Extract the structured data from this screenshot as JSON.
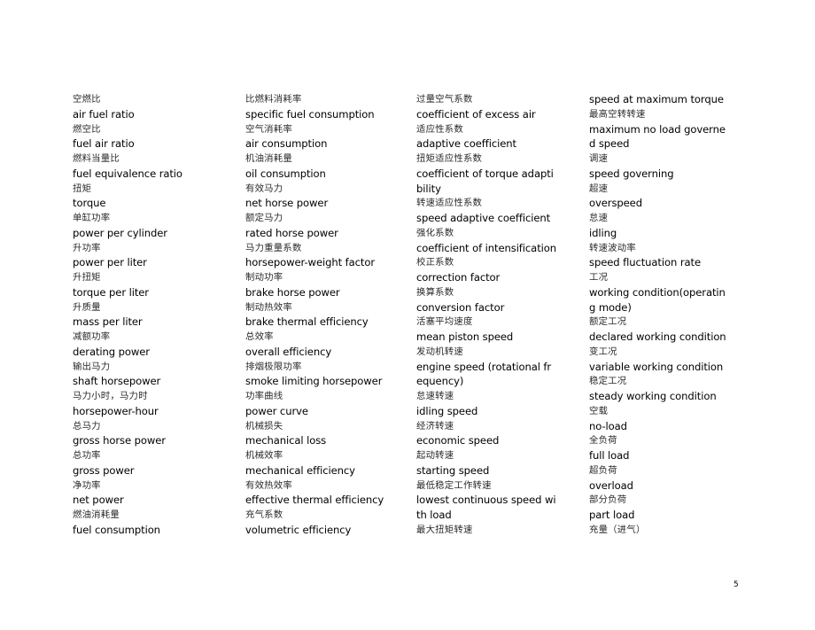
{
  "document": {
    "page_number": "5",
    "background_color": "#ffffff",
    "text_color": "#000000"
  },
  "columns": [
    {
      "id": "column-1",
      "lines": [
        {
          "text": "空燃比",
          "lang": "zh"
        },
        {
          "text": "air fuel ratio",
          "lang": "en"
        },
        {
          "text": "燃空比",
          "lang": "zh"
        },
        {
          "text": "fuel air ratio",
          "lang": "en"
        },
        {
          "text": "燃料当量比",
          "lang": "zh"
        },
        {
          "text": "fuel equivalence ratio",
          "lang": "en"
        },
        {
          "text": "扭矩",
          "lang": "zh"
        },
        {
          "text": "torque",
          "lang": "en"
        },
        {
          "text": "单缸功率",
          "lang": "zh"
        },
        {
          "text": "power per cylinder",
          "lang": "en"
        },
        {
          "text": "升功率",
          "lang": "zh"
        },
        {
          "text": "power per liter",
          "lang": "en"
        },
        {
          "text": "升扭矩",
          "lang": "zh"
        },
        {
          "text": "torque per liter",
          "lang": "en"
        },
        {
          "text": "升质量",
          "lang": "zh"
        },
        {
          "text": "mass per liter",
          "lang": "en"
        },
        {
          "text": "减额功率",
          "lang": "zh"
        },
        {
          "text": "derating power",
          "lang": "en"
        },
        {
          "text": "输出马力",
          "lang": "zh"
        },
        {
          "text": "shaft horsepower",
          "lang": "en"
        },
        {
          "text": "马力小时，马力时",
          "lang": "zh"
        },
        {
          "text": "horsepower-hour",
          "lang": "en"
        },
        {
          "text": "总马力",
          "lang": "zh"
        },
        {
          "text": "gross horse power",
          "lang": "en"
        },
        {
          "text": "总功率",
          "lang": "zh"
        },
        {
          "text": "gross power",
          "lang": "en"
        },
        {
          "text": "净功率",
          "lang": "zh"
        },
        {
          "text": "net power",
          "lang": "en"
        },
        {
          "text": "燃油消耗量",
          "lang": "zh"
        },
        {
          "text": "fuel consumption",
          "lang": "en"
        }
      ]
    },
    {
      "id": "column-2",
      "lines": [
        {
          "text": "比燃料消耗率",
          "lang": "zh"
        },
        {
          "text": "specific fuel consumption",
          "lang": "en"
        },
        {
          "text": "空气消耗率",
          "lang": "zh"
        },
        {
          "text": "air consumption",
          "lang": "en"
        },
        {
          "text": "机油消耗量",
          "lang": "zh"
        },
        {
          "text": "oil consumption",
          "lang": "en"
        },
        {
          "text": "有效马力",
          "lang": "zh"
        },
        {
          "text": "net horse power",
          "lang": "en"
        },
        {
          "text": "额定马力",
          "lang": "zh"
        },
        {
          "text": "rated horse power",
          "lang": "en"
        },
        {
          "text": "马力重量系数",
          "lang": "zh"
        },
        {
          "text": "horsepower-weight factor",
          "lang": "en"
        },
        {
          "text": "制动功率",
          "lang": "zh"
        },
        {
          "text": "brake horse power",
          "lang": "en"
        },
        {
          "text": "制动热效率",
          "lang": "zh"
        },
        {
          "text": "brake thermal efficiency",
          "lang": "en"
        },
        {
          "text": "总效率",
          "lang": "zh"
        },
        {
          "text": "overall efficiency",
          "lang": "en"
        },
        {
          "text": "排烟极限功率",
          "lang": "zh"
        },
        {
          "text": "smoke limiting horsepower",
          "lang": "en"
        },
        {
          "text": "功率曲线",
          "lang": "zh"
        },
        {
          "text": "power curve",
          "lang": "en"
        },
        {
          "text": "机械损失",
          "lang": "zh"
        },
        {
          "text": "mechanical loss",
          "lang": "en"
        },
        {
          "text": "机械效率",
          "lang": "zh"
        },
        {
          "text": "mechanical efficiency",
          "lang": "en"
        },
        {
          "text": "有效热效率",
          "lang": "zh"
        },
        {
          "text": "effective thermal efficiency",
          "lang": "en"
        },
        {
          "text": "充气系数",
          "lang": "zh"
        },
        {
          "text": "volumetric efficiency",
          "lang": "en"
        }
      ]
    },
    {
      "id": "column-3",
      "lines": [
        {
          "text": "过量空气系数",
          "lang": "zh"
        },
        {
          "text": "coefficient of excess air",
          "lang": "en"
        },
        {
          "text": "适应性系数",
          "lang": "zh"
        },
        {
          "text": "adaptive coefficient",
          "lang": "en"
        },
        {
          "text": "扭矩适应性系数",
          "lang": "zh"
        },
        {
          "text": "coefficient of torque adapti",
          "lang": "en"
        },
        {
          "text": "bility",
          "lang": "en"
        },
        {
          "text": "转速适应性系数",
          "lang": "zh"
        },
        {
          "text": "speed adaptive coefficient",
          "lang": "en"
        },
        {
          "text": "强化系数",
          "lang": "zh"
        },
        {
          "text": "coefficient of intensification",
          "lang": "en"
        },
        {
          "text": "校正系数",
          "lang": "zh"
        },
        {
          "text": "correction factor",
          "lang": "en"
        },
        {
          "text": "换算系数",
          "lang": "zh"
        },
        {
          "text": "conversion factor",
          "lang": "en"
        },
        {
          "text": "活塞平均速度",
          "lang": "zh"
        },
        {
          "text": "mean piston speed",
          "lang": "en"
        },
        {
          "text": "发动机转速",
          "lang": "zh"
        },
        {
          "text": "engine speed (rotational fr",
          "lang": "en"
        },
        {
          "text": "equency)",
          "lang": "en"
        },
        {
          "text": "怠速转速",
          "lang": "zh"
        },
        {
          "text": "idling speed",
          "lang": "en"
        },
        {
          "text": "经济转速",
          "lang": "zh"
        },
        {
          "text": "economic speed",
          "lang": "en"
        },
        {
          "text": "起动转速",
          "lang": "zh"
        },
        {
          "text": "starting speed",
          "lang": "en"
        },
        {
          "text": "最低稳定工作转速",
          "lang": "zh"
        },
        {
          "text": "lowest continuous speed wi",
          "lang": "en"
        },
        {
          "text": "th load",
          "lang": "en"
        },
        {
          "text": "最大扭矩转速",
          "lang": "zh"
        }
      ]
    },
    {
      "id": "column-4",
      "lines": [
        {
          "text": "speed at maximum torque",
          "lang": "en"
        },
        {
          "text": "最高空转转速",
          "lang": "zh"
        },
        {
          "text": "maximum no load governe",
          "lang": "en"
        },
        {
          "text": "d speed",
          "lang": "en"
        },
        {
          "text": "调速",
          "lang": "zh"
        },
        {
          "text": "speed governing",
          "lang": "en"
        },
        {
          "text": "超速",
          "lang": "zh"
        },
        {
          "text": "overspeed",
          "lang": "en"
        },
        {
          "text": "怠速",
          "lang": "zh"
        },
        {
          "text": "idling",
          "lang": "en"
        },
        {
          "text": "转速波动率",
          "lang": "zh"
        },
        {
          "text": "speed fluctuation rate",
          "lang": "en"
        },
        {
          "text": "工况",
          "lang": "zh"
        },
        {
          "text": "working condition(operatin",
          "lang": "en"
        },
        {
          "text": "g mode)",
          "lang": "en"
        },
        {
          "text": "额定工况",
          "lang": "zh"
        },
        {
          "text": "declared working condition",
          "lang": "en"
        },
        {
          "text": "变工况",
          "lang": "zh"
        },
        {
          "text": "variable working condition",
          "lang": "en"
        },
        {
          "text": "稳定工况",
          "lang": "zh"
        },
        {
          "text": "steady working condition",
          "lang": "en"
        },
        {
          "text": "空载",
          "lang": "zh"
        },
        {
          "text": "no-load",
          "lang": "en"
        },
        {
          "text": "全负荷",
          "lang": "zh"
        },
        {
          "text": "full load",
          "lang": "en"
        },
        {
          "text": "超负荷",
          "lang": "zh"
        },
        {
          "text": "overload",
          "lang": "en"
        },
        {
          "text": "部分负荷",
          "lang": "zh"
        },
        {
          "text": "part load",
          "lang": "en"
        },
        {
          "text": "充量（进气）",
          "lang": "zh"
        }
      ]
    }
  ]
}
